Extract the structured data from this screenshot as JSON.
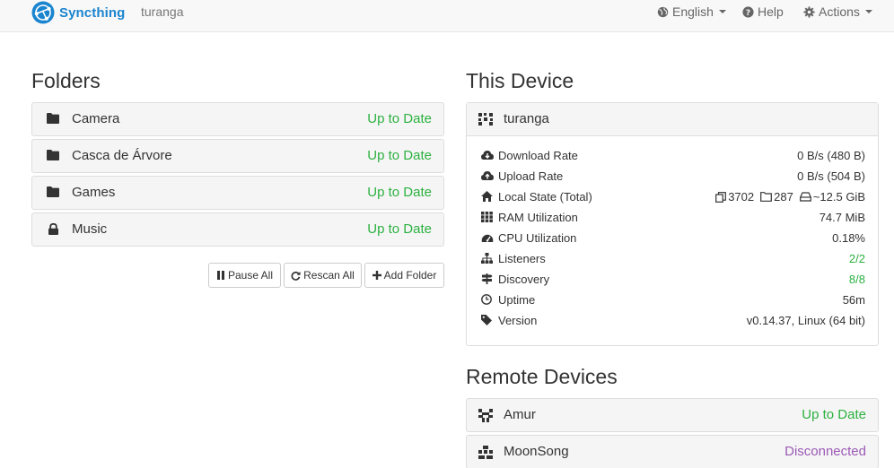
{
  "navbar": {
    "brand": "Syncthing",
    "device_name": "turanga",
    "language": "English",
    "help": "Help",
    "actions": "Actions"
  },
  "folders": {
    "title": "Folders",
    "items": [
      {
        "name": "Camera",
        "status": "Up to Date",
        "icon": "folder-icon"
      },
      {
        "name": "Casca de Árvore",
        "status": "Up to Date",
        "icon": "folder-icon"
      },
      {
        "name": "Games",
        "status": "Up to Date",
        "icon": "folder-icon"
      },
      {
        "name": "Music",
        "status": "Up to Date",
        "icon": "lock-icon"
      }
    ],
    "buttons": {
      "pause_all": "Pause All",
      "rescan_all": "Rescan All",
      "add_folder": "Add Folder"
    }
  },
  "this_device": {
    "title": "This Device",
    "name": "turanga",
    "stats": [
      {
        "key": "Download Rate",
        "value": "0 B/s (480 B)",
        "icon": "cloud-download-icon"
      },
      {
        "key": "Upload Rate",
        "value": "0 B/s (504 B)",
        "icon": "cloud-upload-icon"
      },
      {
        "key": "Local State (Total)",
        "icon": "home-icon"
      },
      {
        "key": "RAM Utilization",
        "value": "74.7 MiB",
        "icon": "ram-icon"
      },
      {
        "key": "CPU Utilization",
        "value": "0.18%",
        "icon": "cpu-gauge-icon"
      },
      {
        "key": "Listeners",
        "value": "2/2",
        "icon": "sitemap-icon"
      },
      {
        "key": "Discovery",
        "value": "8/8",
        "icon": "signpost-icon"
      },
      {
        "key": "Uptime",
        "value": "56m",
        "icon": "clock-icon"
      },
      {
        "key": "Version",
        "value": "v0.14.37, Linux (64 bit)",
        "icon": "tag-icon"
      }
    ],
    "local_state": {
      "files": "3702",
      "folders": "287",
      "size": "~12.5 GiB"
    }
  },
  "remote_devices": {
    "title": "Remote Devices",
    "items": [
      {
        "name": "Amur",
        "status": "Up to Date"
      },
      {
        "name": "MoonSong",
        "status": "Disconnected"
      }
    ]
  },
  "colors": {
    "brand": "#1a84cf",
    "ok": "#2cb140",
    "disconnected": "#9b59b6"
  }
}
